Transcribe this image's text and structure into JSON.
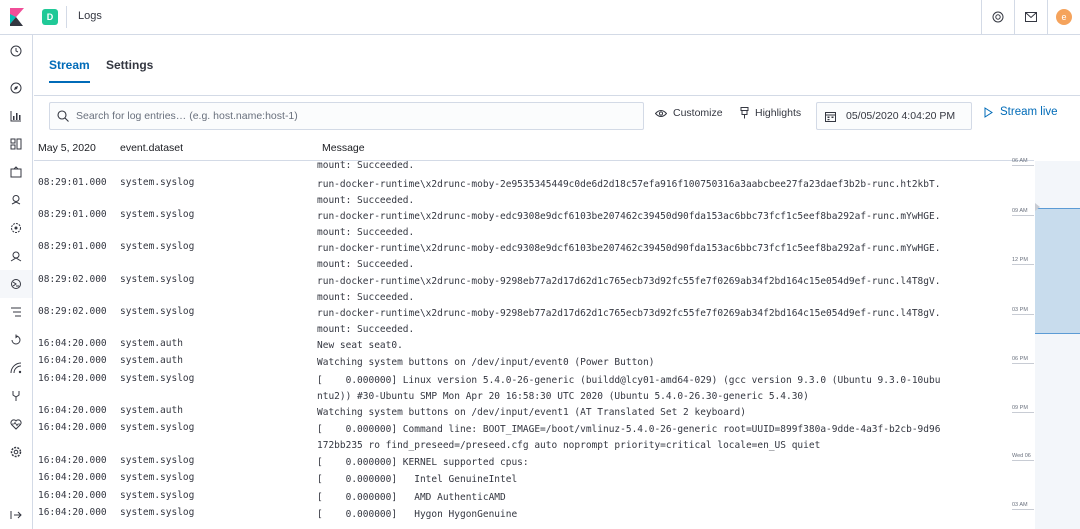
{
  "header": {
    "space_initial": "D",
    "app_title": "Logs",
    "user_initial": "e"
  },
  "tabs": [
    {
      "label": "Stream"
    },
    {
      "label": "Settings"
    }
  ],
  "toolbar": {
    "search_placeholder": "Search for log entries… (e.g. host.name:host-1)",
    "customize_label": "Customize",
    "highlights_label": "Highlights",
    "date_value": "05/05/2020 4:04:20 PM",
    "stream_live_label": "Stream live"
  },
  "columns": {
    "date": "May 5, 2020",
    "dataset": "event.dataset",
    "message": "Message"
  },
  "rows": [
    {
      "ts": "",
      "ds": "",
      "msg": "mount: Succeeded."
    },
    {
      "ts": "08:29:01.000",
      "ds": "system.syslog",
      "msg": "run-docker-runtime\\x2drunc-moby-2e9535345449c0de6d2d18c57efa916f100750316a3aabcbee27fa23daef3b2b-runc.ht2kbT.\nmount: Succeeded."
    },
    {
      "ts": "08:29:01.000",
      "ds": "system.syslog",
      "msg": "run-docker-runtime\\x2drunc-moby-edc9308e9dcf6103be207462c39450d90fda153ac6bbc73fcf1c5eef8ba292af-runc.mYwHGE.\nmount: Succeeded."
    },
    {
      "ts": "08:29:01.000",
      "ds": "system.syslog",
      "msg": "run-docker-runtime\\x2drunc-moby-edc9308e9dcf6103be207462c39450d90fda153ac6bbc73fcf1c5eef8ba292af-runc.mYwHGE.\nmount: Succeeded."
    },
    {
      "ts": "08:29:02.000",
      "ds": "system.syslog",
      "msg": "run-docker-runtime\\x2drunc-moby-9298eb77a2d17d62d1c765ecb73d92fc55fe7f0269ab34f2bd164c15e054d9ef-runc.l4T8gV.\nmount: Succeeded."
    },
    {
      "ts": "08:29:02.000",
      "ds": "system.syslog",
      "msg": "run-docker-runtime\\x2drunc-moby-9298eb77a2d17d62d1c765ecb73d92fc55fe7f0269ab34f2bd164c15e054d9ef-runc.l4T8gV.\nmount: Succeeded."
    },
    {
      "ts": "16:04:20.000",
      "ds": "system.auth",
      "msg": "New seat seat0."
    },
    {
      "ts": "16:04:20.000",
      "ds": "system.auth",
      "msg": "Watching system buttons on /dev/input/event0 (Power Button)"
    },
    {
      "ts": "16:04:20.000",
      "ds": "system.syslog",
      "msg": "[    0.000000] Linux version 5.4.0-26-generic (buildd@lcy01-amd64-029) (gcc version 9.3.0 (Ubuntu 9.3.0-10ubu\nntu2)) #30-Ubuntu SMP Mon Apr 20 16:58:30 UTC 2020 (Ubuntu 5.4.0-26.30-generic 5.4.30)"
    },
    {
      "ts": "16:04:20.000",
      "ds": "system.auth",
      "msg": "Watching system buttons on /dev/input/event1 (AT Translated Set 2 keyboard)"
    },
    {
      "ts": "16:04:20.000",
      "ds": "system.syslog",
      "msg": "[    0.000000] Command line: BOOT_IMAGE=/boot/vmlinuz-5.4.0-26-generic root=UUID=899f380a-9dde-4a3f-b2cb-9d96\n172bb235 ro find_preseed=/preseed.cfg auto noprompt priority=critical locale=en_US quiet"
    },
    {
      "ts": "16:04:20.000",
      "ds": "system.syslog",
      "msg": "[    0.000000] KERNEL supported cpus:"
    },
    {
      "ts": "16:04:20.000",
      "ds": "system.syslog",
      "msg": "[    0.000000]   Intel GenuineIntel"
    },
    {
      "ts": "16:04:20.000",
      "ds": "system.syslog",
      "msg": "[    0.000000]   AMD AuthenticAMD"
    },
    {
      "ts": "16:04:20.000",
      "ds": "system.syslog",
      "msg": "[    0.000000]   Hygon HygonGenuine"
    }
  ],
  "minimap_ticks": [
    {
      "label": "06 AM"
    },
    {
      "label": "09 AM"
    },
    {
      "label": "12 PM"
    },
    {
      "label": "03 PM"
    },
    {
      "label": "06 PM"
    },
    {
      "label": "09 PM"
    },
    {
      "label": "Wed 06"
    },
    {
      "label": "03 AM"
    }
  ],
  "colors": {
    "accent": "#006bb8",
    "space_badge": "#20c997",
    "avatar": "#f5a35c"
  }
}
